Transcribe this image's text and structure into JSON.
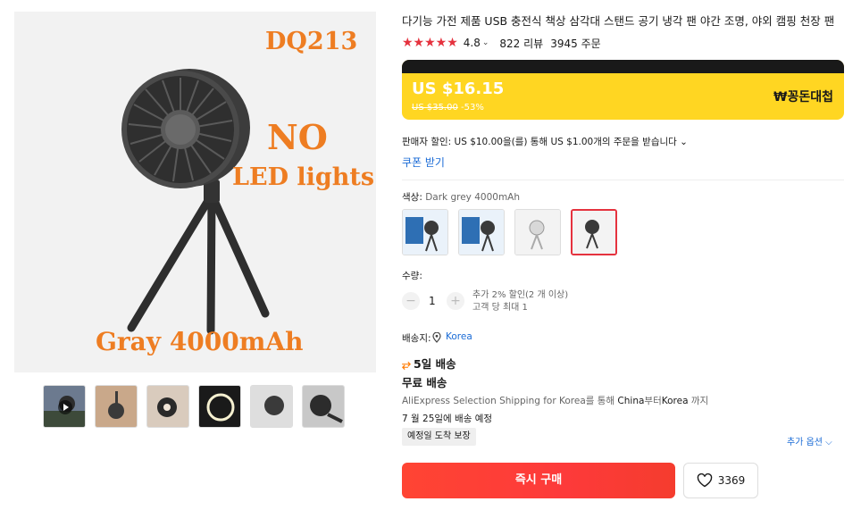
{
  "product": {
    "title": "다기능 가전 제품 USB 충전식 책상 삼각대 스탠드 공기 냉각 팬 야간 조명, 야외 캠핑 천장 팬",
    "image_overlay": {
      "model": "DQ213",
      "no": "NO",
      "led": "LED lights",
      "variant": "Gray 4000mAh"
    },
    "thumbnail_count": 6
  },
  "rating": {
    "stars": "★★★★★",
    "value": "4.8",
    "chevron": "⌄",
    "reviews": "822 리뷰",
    "orders": "3945 주문"
  },
  "price": {
    "current": "US $16.15",
    "original": "US $35.00",
    "discount": "-53%",
    "promo_logo": "₩꽁돈대첩",
    "accent_color": "#ffd622"
  },
  "seller_discount": "판매자 할인: US $10.00을(를) 통해 US $1.00개의 주문을 받습니다 ⌄",
  "coupon_link": "쿠폰 받기",
  "color": {
    "label": "색상: ",
    "selected": "Dark grey 4000mAh",
    "options": [
      "Blue",
      "Blue",
      "White",
      "Dark grey 4000mAh"
    ]
  },
  "quantity": {
    "label": "수량:",
    "minus": "−",
    "value": "1",
    "plus": "+",
    "note_line1": "추가 2% 할인(2 개 이상)",
    "note_line2": "고객 당 최대 1"
  },
  "shipping": {
    "to_label": "배송지: ",
    "to_value": "Korea",
    "days_icon": "⥂",
    "days": "5일 배송",
    "free": "무료 배송",
    "route_prefix": "AliExpress Selection Shipping for Korea를 통해 ",
    "route_from": "China",
    "route_mid": "부터",
    "route_to": "Korea",
    "route_suffix": " 까지",
    "date": "7 월 25일에 배송 예정",
    "guarantee": "예정일 도착 보장",
    "more_options": "추가 옵션 ⌵"
  },
  "actions": {
    "buy_now": "즉시 구매",
    "wishlist_count": "3369"
  }
}
